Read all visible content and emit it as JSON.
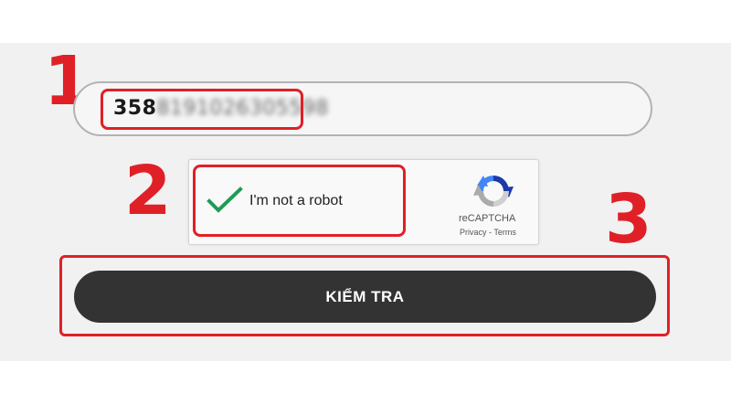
{
  "annotations": {
    "step1": "1",
    "step2": "2",
    "step3": "3"
  },
  "imei_input": {
    "visible_prefix": "358",
    "blurred_rest": "8191026305598"
  },
  "captcha": {
    "label": "I'm not a robot",
    "checked": true,
    "brand": "reCAPTCHA",
    "privacy": "Privacy",
    "separator": "-",
    "terms": "Terms"
  },
  "submit_button": {
    "label": "KIỂM TRA"
  },
  "colors": {
    "annotation_red": "#e02027",
    "button_bg": "#333333",
    "check_green": "#1e9b54",
    "panel_bg": "#f1f1f1"
  }
}
